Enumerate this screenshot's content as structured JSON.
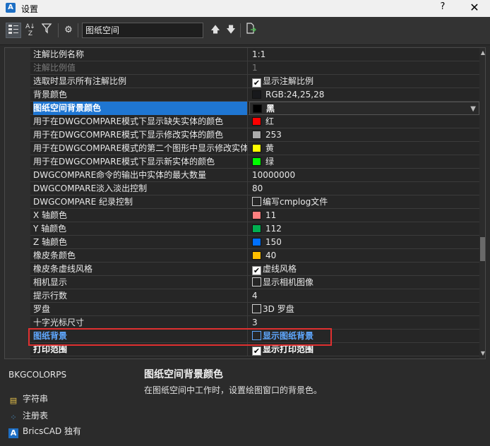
{
  "window": {
    "title": "设置",
    "help": "?",
    "close": "✕",
    "app_icon": "A"
  },
  "toolbar": {
    "search_value": "图纸空间",
    "buttons": [
      "categorized-view-icon",
      "alphabetical-sort-icon",
      "filter-icon",
      "settings-gear-icon",
      "arrow-up-icon",
      "arrow-down-icon",
      "export-icon"
    ]
  },
  "rows": [
    {
      "name": "注解比例名称",
      "value": "1:1",
      "kind": "text"
    },
    {
      "name": "注解比例值",
      "value": "1",
      "kind": "text",
      "disabled": true
    },
    {
      "name": "选取时显示所有注解比例",
      "value": "显示注解比例",
      "kind": "check",
      "checked": true
    },
    {
      "name": "背景颜色",
      "value": "RGB:24,25,28",
      "kind": "color",
      "color": "#18191c"
    },
    {
      "name": "图纸空间背景颜色",
      "value": "黑",
      "kind": "color",
      "color": "#000000",
      "selected": true
    },
    {
      "name": "用于在DWGCOMPARE模式下显示缺失实体的颜色",
      "value": "红",
      "kind": "color",
      "color": "#ff0000"
    },
    {
      "name": "用于在DWGCOMPARE模式下显示修改实体的颜色",
      "value": "253",
      "kind": "color",
      "color": "#ababab"
    },
    {
      "name": "用于在DWGCOMPARE模式的第二个图形中显示修改实体的颜色",
      "value": "黄",
      "kind": "color",
      "color": "#ffff00"
    },
    {
      "name": "用于在DWGCOMPARE模式下显示新实体的颜色",
      "value": "绿",
      "kind": "color",
      "color": "#00ff00"
    },
    {
      "name": "DWGCOMPARE命令的输出中实体的最大数量",
      "value": "10000000",
      "kind": "text"
    },
    {
      "name": "DWGCOMPARE淡入淡出控制",
      "value": "80",
      "kind": "text"
    },
    {
      "name": "DWGCOMPARE 纪录控制",
      "value": "编写cmplog文件",
      "kind": "check",
      "checked": false
    },
    {
      "name": "X 轴颜色",
      "value": "11",
      "kind": "color",
      "color": "#ff7f7f"
    },
    {
      "name": "Y 轴颜色",
      "value": "112",
      "kind": "color",
      "color": "#00b050"
    },
    {
      "name": "Z 轴颜色",
      "value": "150",
      "kind": "color",
      "color": "#0070ff"
    },
    {
      "name": "橡皮条颜色",
      "value": "40",
      "kind": "color",
      "color": "#ffbf00"
    },
    {
      "name": "橡皮条虚线风格",
      "value": "虚线风格",
      "kind": "check",
      "checked": true
    },
    {
      "name": "相机显示",
      "value": "显示相机图像",
      "kind": "check",
      "checked": false
    },
    {
      "name": "提示行数",
      "value": "4",
      "kind": "text"
    },
    {
      "name": "罗盘",
      "value": "3D 罗盘",
      "kind": "check",
      "checked": false
    },
    {
      "name": "十字光标尺寸",
      "value": "3",
      "kind": "text"
    },
    {
      "name": "图纸背景",
      "value": "显示图纸背景",
      "kind": "check",
      "checked": false,
      "highlight": true
    },
    {
      "name": "打印范围",
      "value": "显示打印范围",
      "kind": "check",
      "checked": true,
      "cut": true
    }
  ],
  "detail": {
    "variable": "BKGCOLORPS",
    "title": "图纸空间背景颜色",
    "description": "在图纸空间中工作时，设置绘图窗口的背景色。"
  },
  "info": [
    {
      "icon": "string-type-icon",
      "label": "字符串"
    },
    {
      "icon": "registry-icon",
      "label": "注册表"
    },
    {
      "icon": "bricscad-icon",
      "label": "BricsCAD 独有"
    }
  ]
}
